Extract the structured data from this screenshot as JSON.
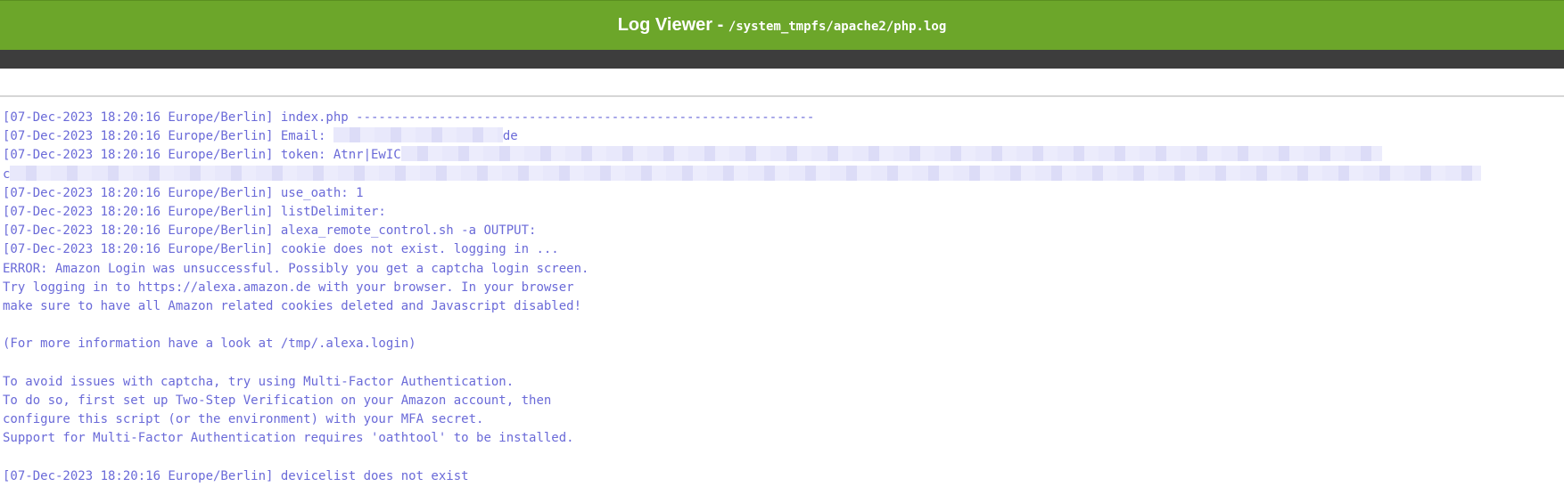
{
  "header": {
    "title": "Log Viewer - ",
    "path": "/system_tmpfs/apache2/php.log"
  },
  "log": {
    "lines": [
      "[07-Dec-2023 18:20:16 Europe/Berlin] index.php -------------------------------------------------------------",
      "[07-Dec-2023 18:20:16 Europe/Berlin] Email: ",
      "de",
      "[07-Dec-2023 18:20:16 Europe/Berlin] token: Atnr|EwIC",
      "c",
      "[07-Dec-2023 18:20:16 Europe/Berlin] use_oath: 1",
      "[07-Dec-2023 18:20:16 Europe/Berlin] listDelimiter:",
      "[07-Dec-2023 18:20:16 Europe/Berlin] alexa_remote_control.sh -a OUTPUT:",
      "[07-Dec-2023 18:20:16 Europe/Berlin] cookie does not exist. logging in ...",
      "ERROR: Amazon Login was unsuccessful. Possibly you get a captcha login screen.",
      "Try logging in to https://alexa.amazon.de with your browser. In your browser",
      "make sure to have all Amazon related cookies deleted and Javascript disabled!",
      "",
      "(For more information have a look at /tmp/.alexa.login)",
      "",
      "To avoid issues with captcha, try using Multi-Factor Authentication.",
      "To do so, first set up Two-Step Verification on your Amazon account, then",
      "configure this script (or the environment) with your MFA secret.",
      "Support for Multi-Factor Authentication requires 'oathtool' to be installed.",
      "",
      "[07-Dec-2023 18:20:16 Europe/Berlin] devicelist does not exist"
    ]
  }
}
